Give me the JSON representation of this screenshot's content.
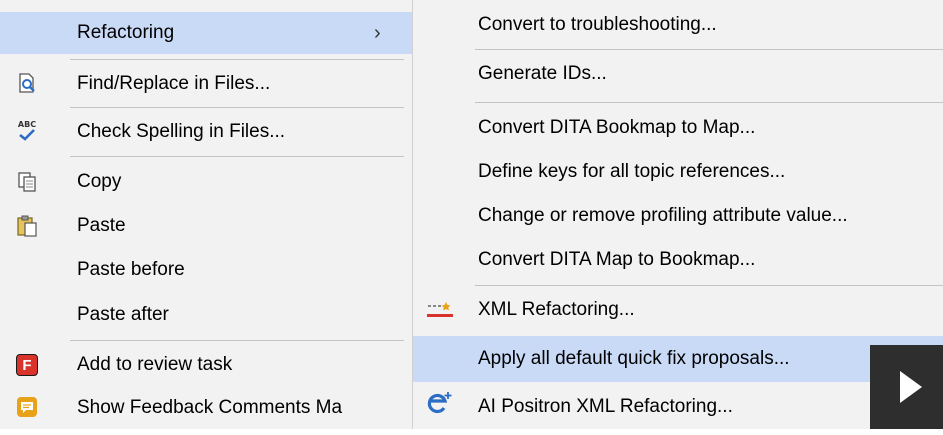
{
  "left_menu": {
    "items": [
      {
        "label": "Refactoring",
        "submenu_arrow": "›",
        "icon": "none",
        "highlighted": true
      },
      {
        "label": "Find/Replace in Files...",
        "icon": "find-replace-icon"
      },
      {
        "label": "Check Spelling in Files...",
        "icon": "spell-check-icon",
        "icon_text": "ABC"
      },
      {
        "label": "Copy",
        "icon": "copy-icon"
      },
      {
        "label": "Paste",
        "icon": "paste-icon"
      },
      {
        "label": "Paste before",
        "icon": "none"
      },
      {
        "label": "Paste after",
        "icon": "none"
      },
      {
        "label": "Add to review task",
        "icon": "review-task-icon",
        "icon_text": "F"
      },
      {
        "label": "Show Feedback Comments Ma",
        "icon": "feedback-comments-icon"
      }
    ]
  },
  "right_menu": {
    "items": [
      {
        "label": "Convert to troubleshooting...",
        "icon": "none"
      },
      {
        "label": "Generate IDs...",
        "icon": "none"
      },
      {
        "label": "Convert DITA Bookmap to Map...",
        "icon": "none"
      },
      {
        "label": "Define keys for all topic references...",
        "icon": "none"
      },
      {
        "label": "Change or remove profiling attribute value...",
        "icon": "none"
      },
      {
        "label": "Convert DITA Map to Bookmap...",
        "icon": "none"
      },
      {
        "label": "XML Refactoring...",
        "icon": "xml-refactoring-icon"
      },
      {
        "label": "Apply all default quick fix proposals...",
        "icon": "none",
        "highlighted": true
      },
      {
        "label": "AI Positron XML Refactoring...",
        "icon": "ai-positron-icon"
      }
    ]
  },
  "overlay": {
    "icon": "play-icon"
  },
  "colors": {
    "menu_bg": "#f2f2f2",
    "highlight": "#c9daf7",
    "icon_blue": "#2b6cc4",
    "icon_red": "#d9342b",
    "icon_orange": "#e8a21a"
  }
}
